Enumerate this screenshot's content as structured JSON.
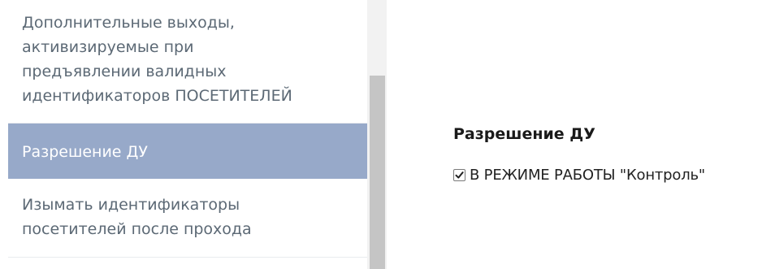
{
  "sidebar": {
    "items": [
      {
        "label": "Дополнительные выходы,\nактивизируемые при\nпредъявлении валидных\nидентификаторов ПОСЕТИТЕЛЕЙ",
        "selected": false
      },
      {
        "label": "Разрешение ДУ",
        "selected": true
      },
      {
        "label": "Изымать идентификаторы\nпосетителей после прохода",
        "selected": false
      }
    ],
    "selected_bg": "#97a9c9"
  },
  "detail": {
    "title": "Разрешение ДУ",
    "option": {
      "label": "В РЕЖИМЕ РАБОТЫ \"Контроль\"",
      "checked": true
    }
  }
}
